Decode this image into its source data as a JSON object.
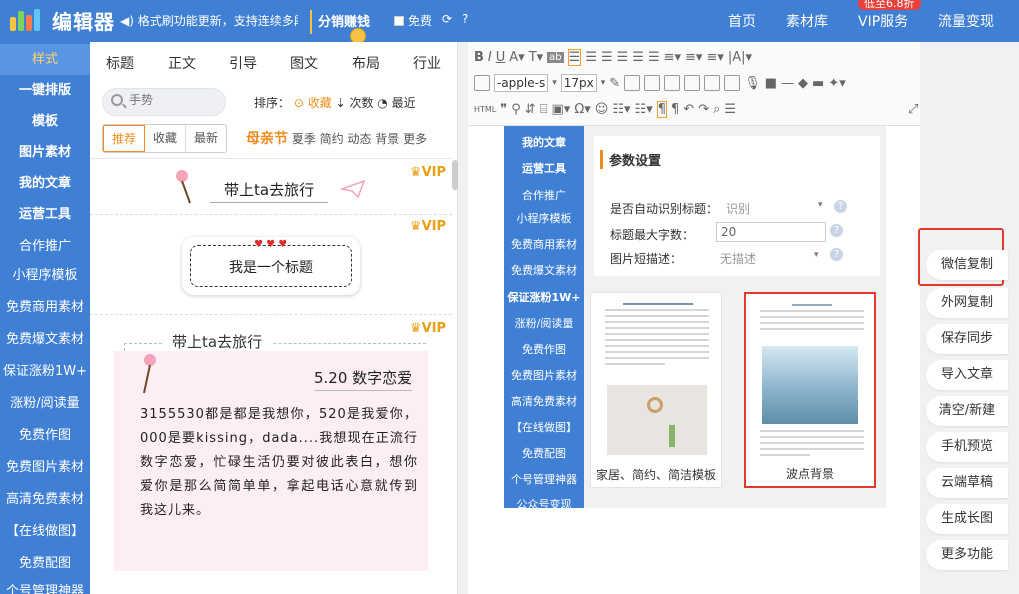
{
  "app": {
    "title": "编辑器",
    "notice": "格式刷功能更新，支持连续多段落使用",
    "promo": "分销赚钱",
    "free_label": "免费"
  },
  "topnav": {
    "items": [
      "首页",
      "素材库",
      "VIP服务",
      "流量变现"
    ],
    "vip_badge": "低至6.8折"
  },
  "sidebar": {
    "items": [
      "样式",
      "一键排版",
      "模板",
      "图片素材",
      "我的文章",
      "运营工具",
      "合作推广",
      "小程序模板",
      "免费商用素材",
      "免费爆文素材",
      "保证涨粉1W+",
      "涨粉/阅读量",
      "免费作图",
      "免费图片素材",
      "高清免费素材",
      "【在线做图】",
      "免费配图",
      "个号管理神器"
    ]
  },
  "panel": {
    "tabs": [
      "标题",
      "正文",
      "引导",
      "图文",
      "布局",
      "行业"
    ],
    "search_placeholder": "手势",
    "sort_label": "排序：",
    "sort_hot": "收藏",
    "sort_count": "次数",
    "sort_recent": "最近",
    "chips": [
      "推荐",
      "收藏",
      "最新"
    ],
    "special_tag": "母亲节",
    "tags": "夏季  简约  动态  背景  更多",
    "vip_label": "VIP",
    "tpl1_text": "带上ta去旅行",
    "tpl2_text": "我是一个标题",
    "tpl3_title": "带上ta去旅行",
    "tpl3_heading": "5.20 数字恋爱",
    "tpl3_body": "3155530都是都是我想你，520是我爱你，000是要kissing，dada....我想现在正流行数字恋爱，忙碌生活仍要对彼此表白，想你爱你是那么简简单单，拿起电话心意就传到我这儿来。"
  },
  "editor": {
    "font_family": "-apple-s",
    "font_size": "17px",
    "html_label": "HTML",
    "inner_menu": [
      "我的文章",
      "运营工具",
      "合作推广",
      "小程序模板",
      "免费商用素材",
      "免费爆文素材",
      "保证涨粉1W+",
      "涨粉/阅读量",
      "免费作图",
      "免费图片素材",
      "高清免费素材",
      "【在线做图】",
      "免费配图",
      "个号管理神器",
      "公众号变现"
    ],
    "params": {
      "title": "参数设置",
      "auto_title_label": "是否自动识别标题：",
      "auto_title_value": "识别",
      "max_title_label": "标题最大字数：",
      "max_title_value": "20",
      "desc_label": "图片短描述：",
      "desc_value": "无描述"
    },
    "cards": [
      {
        "caption": "家居、简约、简洁模板"
      },
      {
        "caption": "波点背景"
      }
    ]
  },
  "actions": [
    "微信复制",
    "外网复制",
    "保存同步",
    "导入文章",
    "清空/新建",
    "手机预览",
    "云端草稿",
    "生成长图",
    "更多功能"
  ],
  "colors": {
    "primary": "#3f7fd4",
    "accent": "#f08c1f",
    "highlight": "#e03a30"
  }
}
